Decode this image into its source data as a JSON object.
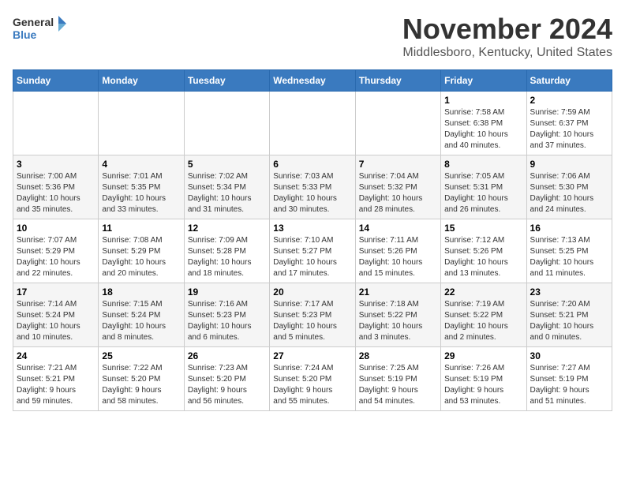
{
  "header": {
    "logo_line1": "General",
    "logo_line2": "Blue",
    "month": "November 2024",
    "location": "Middlesboro, Kentucky, United States"
  },
  "weekdays": [
    "Sunday",
    "Monday",
    "Tuesday",
    "Wednesday",
    "Thursday",
    "Friday",
    "Saturday"
  ],
  "weeks": [
    [
      {
        "day": "",
        "info": ""
      },
      {
        "day": "",
        "info": ""
      },
      {
        "day": "",
        "info": ""
      },
      {
        "day": "",
        "info": ""
      },
      {
        "day": "",
        "info": ""
      },
      {
        "day": "1",
        "info": "Sunrise: 7:58 AM\nSunset: 6:38 PM\nDaylight: 10 hours\nand 40 minutes."
      },
      {
        "day": "2",
        "info": "Sunrise: 7:59 AM\nSunset: 6:37 PM\nDaylight: 10 hours\nand 37 minutes."
      }
    ],
    [
      {
        "day": "3",
        "info": "Sunrise: 7:00 AM\nSunset: 5:36 PM\nDaylight: 10 hours\nand 35 minutes."
      },
      {
        "day": "4",
        "info": "Sunrise: 7:01 AM\nSunset: 5:35 PM\nDaylight: 10 hours\nand 33 minutes."
      },
      {
        "day": "5",
        "info": "Sunrise: 7:02 AM\nSunset: 5:34 PM\nDaylight: 10 hours\nand 31 minutes."
      },
      {
        "day": "6",
        "info": "Sunrise: 7:03 AM\nSunset: 5:33 PM\nDaylight: 10 hours\nand 30 minutes."
      },
      {
        "day": "7",
        "info": "Sunrise: 7:04 AM\nSunset: 5:32 PM\nDaylight: 10 hours\nand 28 minutes."
      },
      {
        "day": "8",
        "info": "Sunrise: 7:05 AM\nSunset: 5:31 PM\nDaylight: 10 hours\nand 26 minutes."
      },
      {
        "day": "9",
        "info": "Sunrise: 7:06 AM\nSunset: 5:30 PM\nDaylight: 10 hours\nand 24 minutes."
      }
    ],
    [
      {
        "day": "10",
        "info": "Sunrise: 7:07 AM\nSunset: 5:29 PM\nDaylight: 10 hours\nand 22 minutes."
      },
      {
        "day": "11",
        "info": "Sunrise: 7:08 AM\nSunset: 5:29 PM\nDaylight: 10 hours\nand 20 minutes."
      },
      {
        "day": "12",
        "info": "Sunrise: 7:09 AM\nSunset: 5:28 PM\nDaylight: 10 hours\nand 18 minutes."
      },
      {
        "day": "13",
        "info": "Sunrise: 7:10 AM\nSunset: 5:27 PM\nDaylight: 10 hours\nand 17 minutes."
      },
      {
        "day": "14",
        "info": "Sunrise: 7:11 AM\nSunset: 5:26 PM\nDaylight: 10 hours\nand 15 minutes."
      },
      {
        "day": "15",
        "info": "Sunrise: 7:12 AM\nSunset: 5:26 PM\nDaylight: 10 hours\nand 13 minutes."
      },
      {
        "day": "16",
        "info": "Sunrise: 7:13 AM\nSunset: 5:25 PM\nDaylight: 10 hours\nand 11 minutes."
      }
    ],
    [
      {
        "day": "17",
        "info": "Sunrise: 7:14 AM\nSunset: 5:24 PM\nDaylight: 10 hours\nand 10 minutes."
      },
      {
        "day": "18",
        "info": "Sunrise: 7:15 AM\nSunset: 5:24 PM\nDaylight: 10 hours\nand 8 minutes."
      },
      {
        "day": "19",
        "info": "Sunrise: 7:16 AM\nSunset: 5:23 PM\nDaylight: 10 hours\nand 6 minutes."
      },
      {
        "day": "20",
        "info": "Sunrise: 7:17 AM\nSunset: 5:23 PM\nDaylight: 10 hours\nand 5 minutes."
      },
      {
        "day": "21",
        "info": "Sunrise: 7:18 AM\nSunset: 5:22 PM\nDaylight: 10 hours\nand 3 minutes."
      },
      {
        "day": "22",
        "info": "Sunrise: 7:19 AM\nSunset: 5:22 PM\nDaylight: 10 hours\nand 2 minutes."
      },
      {
        "day": "23",
        "info": "Sunrise: 7:20 AM\nSunset: 5:21 PM\nDaylight: 10 hours\nand 0 minutes."
      }
    ],
    [
      {
        "day": "24",
        "info": "Sunrise: 7:21 AM\nSunset: 5:21 PM\nDaylight: 9 hours\nand 59 minutes."
      },
      {
        "day": "25",
        "info": "Sunrise: 7:22 AM\nSunset: 5:20 PM\nDaylight: 9 hours\nand 58 minutes."
      },
      {
        "day": "26",
        "info": "Sunrise: 7:23 AM\nSunset: 5:20 PM\nDaylight: 9 hours\nand 56 minutes."
      },
      {
        "day": "27",
        "info": "Sunrise: 7:24 AM\nSunset: 5:20 PM\nDaylight: 9 hours\nand 55 minutes."
      },
      {
        "day": "28",
        "info": "Sunrise: 7:25 AM\nSunset: 5:19 PM\nDaylight: 9 hours\nand 54 minutes."
      },
      {
        "day": "29",
        "info": "Sunrise: 7:26 AM\nSunset: 5:19 PM\nDaylight: 9 hours\nand 53 minutes."
      },
      {
        "day": "30",
        "info": "Sunrise: 7:27 AM\nSunset: 5:19 PM\nDaylight: 9 hours\nand 51 minutes."
      }
    ]
  ]
}
